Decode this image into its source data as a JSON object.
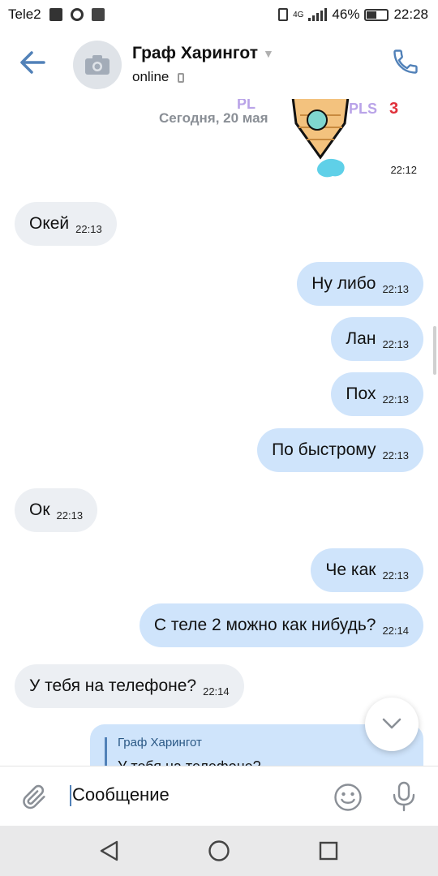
{
  "status_bar": {
    "carrier": "Tele2",
    "network": "4G",
    "battery": "46%",
    "time": "22:28"
  },
  "header": {
    "name": "Граф Харингот",
    "status": "online"
  },
  "chat": {
    "date_label": "Сегодня, 20 мая",
    "sticker_time": "22:12",
    "messages": [
      {
        "direction": "in",
        "text": "Окей",
        "time": "22:13"
      },
      {
        "direction": "out",
        "text": "Ну либо",
        "time": "22:13"
      },
      {
        "direction": "out",
        "text": "Лан",
        "time": "22:13"
      },
      {
        "direction": "out",
        "text": "Пох",
        "time": "22:13"
      },
      {
        "direction": "out",
        "text": "По быстрому",
        "time": "22:13"
      },
      {
        "direction": "in",
        "text": "Ок",
        "time": "22:13"
      },
      {
        "direction": "out",
        "text": "Че как",
        "time": "22:13"
      },
      {
        "direction": "out",
        "text": "С теле 2 можно как нибудь?",
        "time": "22:14"
      },
      {
        "direction": "in",
        "text": "У тебя на телефоне?",
        "time": "22:14"
      }
    ],
    "reply": {
      "author": "Граф Харингот",
      "quoted_text": "У тебя на телефоне?"
    }
  },
  "composer": {
    "placeholder": "Сообщение"
  },
  "colors": {
    "accent": "#5181b8",
    "outgoing_bubble": "#cfe4fb",
    "incoming_bubble": "#eceff3"
  },
  "icons": [
    "back-arrow-icon",
    "camera-icon",
    "phone-icon",
    "chevron-down-icon",
    "paperclip-icon",
    "smile-icon",
    "microphone-icon",
    "nav-back-icon",
    "nav-home-icon",
    "nav-recents-icon"
  ]
}
